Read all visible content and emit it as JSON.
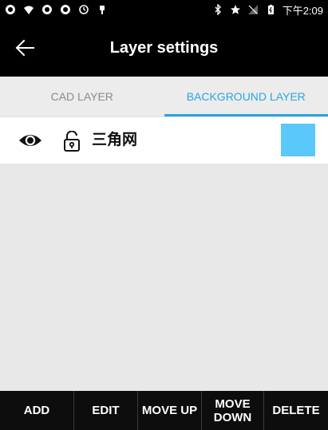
{
  "status_bar": {
    "time": "下午2:09",
    "icons": [
      "app-icon",
      "wifi-icon",
      "app-icon",
      "app-icon",
      "sync-icon",
      "usb-icon",
      "bluetooth-icon",
      "star-icon",
      "signal-icon",
      "battery-icon"
    ]
  },
  "app_bar": {
    "title": "Layer settings",
    "back_icon": "back-arrow-icon"
  },
  "tabs": [
    {
      "label": "CAD LAYER",
      "active": false
    },
    {
      "label": "BACKGROUND LAYER",
      "active": true
    }
  ],
  "colors": {
    "accent": "#29a6de",
    "swatch": "#5ac8fa"
  },
  "layers": [
    {
      "name": "三角网",
      "visible": true,
      "locked": false,
      "color": "#5ac8fa"
    }
  ],
  "toolbar": {
    "add_label": "ADD",
    "edit_label": "EDIT",
    "move_up_label": "MOVE UP",
    "move_down_line1": "MOVE",
    "move_down_line2": "DOWN",
    "delete_label": "DELETE"
  }
}
